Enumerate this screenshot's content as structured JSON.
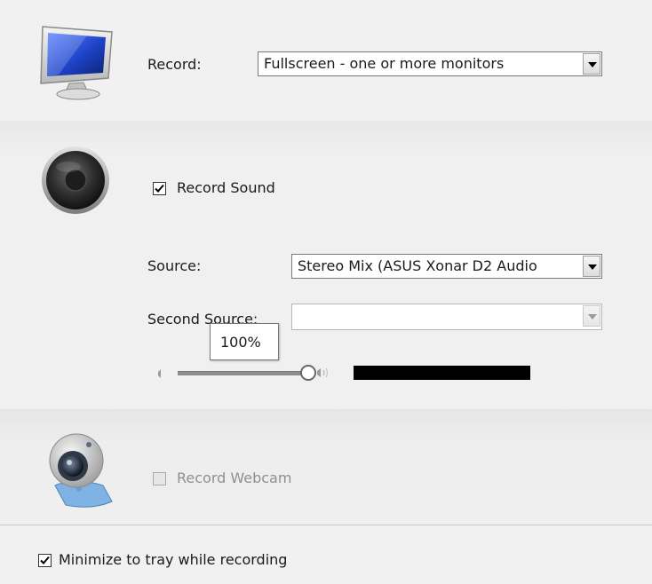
{
  "record_section": {
    "label": "Record:",
    "mode_value": "Fullscreen - one or more monitors"
  },
  "sound_section": {
    "record_sound_label": "Record Sound",
    "record_sound_checked": true,
    "source_label": "Source:",
    "source_value": "Stereo Mix (ASUS Xonar D2 Audio",
    "second_source_label": "Second Source:",
    "second_source_value": "",
    "volume_tooltip": "100%",
    "volume_level": 1.0
  },
  "webcam_section": {
    "record_webcam_label": "Record Webcam",
    "record_webcam_checked": false,
    "record_webcam_enabled": false
  },
  "footer": {
    "minimize_label": "Minimize to tray while recording",
    "minimize_checked": true
  },
  "colors": {
    "level_meter": "#000000",
    "monitor_screen": "#1f43c9",
    "webcam_body": "#7fb3e4"
  },
  "icons": {
    "record": "monitor-icon",
    "sound": "speaker-icon",
    "webcam": "webcam-icon",
    "volume_min": "volume-low-icon",
    "volume_max": "volume-high-icon"
  }
}
